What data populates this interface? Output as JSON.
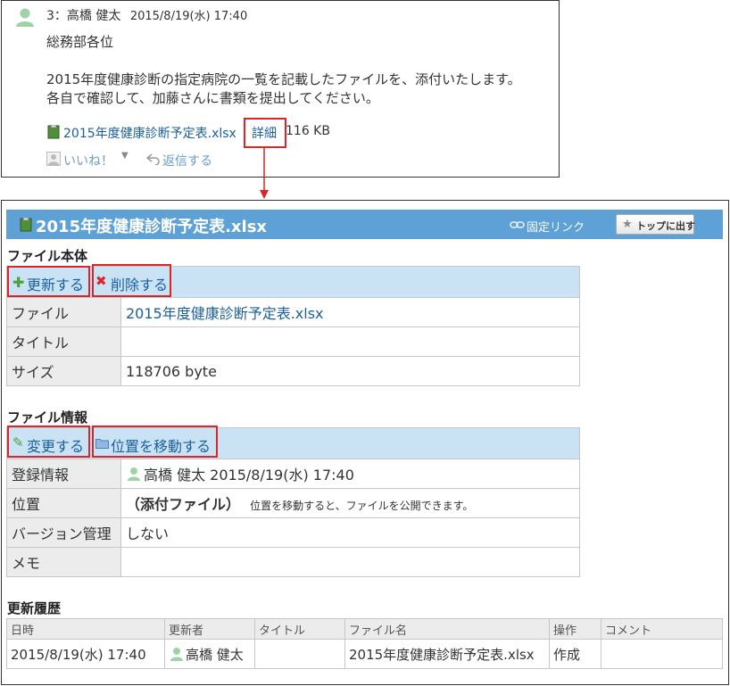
{
  "comment": {
    "number": "3",
    "author": "高橋 健太",
    "timestamp": "2015/8/19(水) 17:40",
    "salutation": "総務部各位",
    "body_line1": "2015年度健康診断の指定病院の一覧を記載したファイルを、添付いたします。",
    "body_line2": "各自で確認して、加藤さんに書類を提出してください。",
    "attachment_name": "2015年度健康診断予定表.xlsx",
    "detail_link": "詳細",
    "file_size": "116 KB",
    "like_label": "いいね！",
    "reply_label": "返信する"
  },
  "detail": {
    "title": "2015年度健康診断予定表.xlsx",
    "permalink_label": "固定リンク",
    "top_button_label": "トップに出す",
    "file_section": {
      "heading": "ファイル本体",
      "update_label": "更新する",
      "delete_label": "削除する",
      "rows": [
        {
          "label": "ファイル",
          "value": "2015年度健康診断予定表.xlsx"
        },
        {
          "label": "タイトル",
          "value": ""
        },
        {
          "label": "サイズ",
          "value": "118706 byte"
        }
      ]
    },
    "info_section": {
      "heading": "ファイル情報",
      "change_label": "変更する",
      "move_label": "位置を移動する",
      "registered_label": "登録情報",
      "registered_value": "高橋 健太 2015/8/19(水) 17:40",
      "location_label": "位置",
      "location_value": "（添付ファイル）",
      "location_note": "位置を移動すると、ファイルを公開できます。",
      "version_label": "バージョン管理",
      "version_value": "しない",
      "memo_label": "メモ",
      "memo_value": ""
    },
    "history": {
      "heading": "更新履歴",
      "columns": [
        "日時",
        "更新者",
        "タイトル",
        "ファイル名",
        "操作",
        "コメント"
      ],
      "rows": [
        {
          "datetime": "2015/8/19(水) 17:40",
          "user": "高橋 健太",
          "title": "",
          "filename": "2015年度健康診断予定表.xlsx",
          "operation": "作成",
          "comment": ""
        }
      ]
    }
  },
  "colors": {
    "title_bar": "#5ea1d6",
    "action_bar": "#c9e3f5",
    "highlight_box": "#d9262b",
    "link": "#1a5f9e"
  }
}
